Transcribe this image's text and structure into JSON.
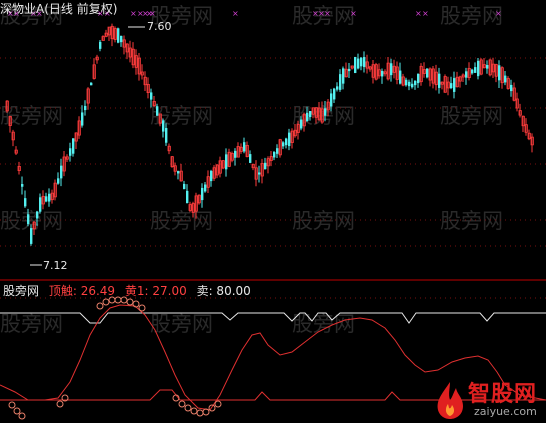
{
  "header": {
    "title": "深物业A(日线 前复权)"
  },
  "main_chart": {
    "high_label": "7.60",
    "low_label": "7.12"
  },
  "indicator": {
    "name": "股旁网",
    "items": [
      {
        "label": "顶触: 26.49",
        "color": "#ff4040"
      },
      {
        "label": "黄1: 27.00",
        "color": "#ff4040"
      },
      {
        "label": "卖: 80.00",
        "color": "#e8e8e8"
      }
    ]
  },
  "watermark": "股旁网",
  "logo": {
    "name": "智股网",
    "url": "zaiyue.com"
  },
  "colors": {
    "up": "#ff3c3c",
    "down": "#54f0f0",
    "divider": "#c00000",
    "line_white": "#e8e8e8",
    "line_red": "#e03030",
    "marker": "#d040d0"
  }
}
